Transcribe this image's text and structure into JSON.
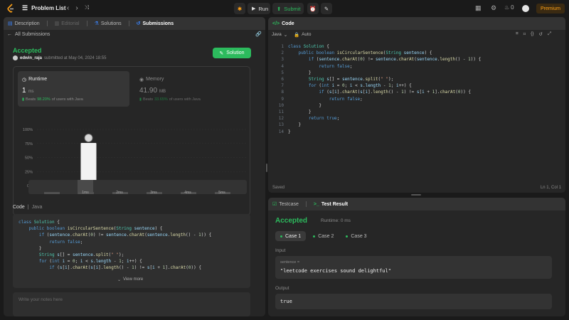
{
  "topbar": {
    "problem_list": "Problem List",
    "run": "Run",
    "submit": "Submit",
    "streak": "0",
    "premium": "Premium"
  },
  "left_tabs": [
    "Description",
    "Editorial",
    "Solutions",
    "Submissions"
  ],
  "submission": {
    "back": "All Submissions",
    "status": "Accepted",
    "user": "edwin_raja",
    "submitted": "submitted at May 04, 2024 18:55",
    "solution_btn": "Solution",
    "runtime_label": "Runtime",
    "runtime_value": "1",
    "runtime_unit": "ms",
    "runtime_beats_prefix": "Beats",
    "runtime_beats": "98.20%",
    "runtime_beats_suffix": "of users with Java",
    "memory_label": "Memory",
    "memory_value": "41.90",
    "memory_unit": "MB",
    "memory_beats_prefix": "Beats",
    "memory_beats": "33.65%",
    "memory_beats_suffix": "of users with Java"
  },
  "chart_data": {
    "type": "bar",
    "categories": [
      "",
      "1ms",
      "2ms",
      "3ms",
      "4ms",
      "5ms"
    ],
    "values": [
      2,
      76,
      9,
      2,
      2,
      2
    ],
    "ylim": [
      0,
      100
    ],
    "y_ticks": [
      "100%",
      "75%",
      "50%",
      "25%",
      "0%"
    ],
    "x_labels": [
      "1ms",
      "2ms",
      "3ms",
      "4ms",
      "5ms"
    ],
    "highlight": "1ms"
  },
  "minimap_labels": [
    "1ms",
    "2ms",
    "3ms",
    "4ms",
    "5ms"
  ],
  "code_header": {
    "label": "Code",
    "lang": "Java"
  },
  "view_more": "View more",
  "notes_placeholder": "Write your notes here",
  "editor": {
    "title": "Code",
    "lang": "Java",
    "auto": "Auto",
    "saved": "Saved",
    "position": "Ln 1, Col 1",
    "lines": [
      "class Solution {",
      "    public boolean isCircularSentence(String sentence) {",
      "        if (sentence.charAt(0) != sentence.charAt(sentence.length() - 1)) {",
      "            return false;",
      "        }",
      "        String s[] = sentence.split(\" \");",
      "        for (int i = 0; i < s.length - 1; i++) {",
      "            if (s[i].charAt(s[i].length() - 1) != s[i + 1].charAt(0)) {",
      "                return false;",
      "            }",
      "        }",
      "        return true;",
      "    }",
      "}"
    ]
  },
  "preview_lines": [
    "class Solution {",
    "    public boolean isCircularSentence(String sentence) {",
    "        if (sentence.charAt(0) != sentence.charAt(sentence.length() - 1)) {",
    "            return false;",
    "        }",
    "        String s[] = sentence.split(\" \");",
    "        for (int i = 0; i < s.length - 1; i++) {",
    "            if (s[i].charAt(s[i].length() - 1) != s[i + 1].charAt(0)) {"
  ],
  "test": {
    "tab1": "Testcase",
    "tab2": "Test Result",
    "status": "Accepted",
    "runtime": "Runtime: 0 ms",
    "cases": [
      "Case 1",
      "Case 2",
      "Case 3"
    ],
    "input_label": "Input",
    "var_label": "sentence =",
    "input_value": "\"leetcode exercises sound delightful\"",
    "output_label": "Output",
    "output_value": "true"
  },
  "colors": {
    "accent_green": "#2cbb5d",
    "premium": "#ffa116",
    "bg": "#1a1a1a",
    "panel": "#262626"
  }
}
